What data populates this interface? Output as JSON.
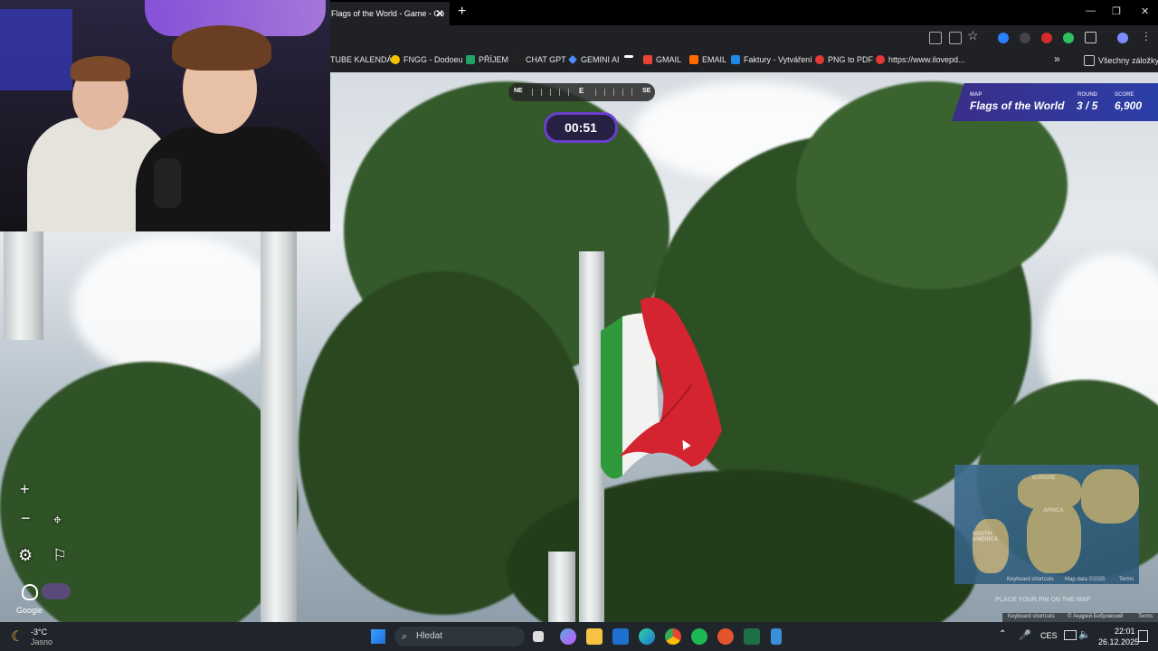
{
  "browser": {
    "tab_title": "Flags of the World - Game - Ge",
    "new_tab": "+",
    "close_tab": "✕",
    "window": {
      "minimize": "—",
      "restore": "❐",
      "close": "✕"
    },
    "bookmarks": [
      {
        "label": "TUBE KALENDÁŘ",
        "color": "#ff0000"
      },
      {
        "label": "FNGG - Dodoeu",
        "color": "#f5c400"
      },
      {
        "label": "PŘÍJEM",
        "color": "#1fa463"
      },
      {
        "label": "CHAT GPT",
        "color": "#222222"
      },
      {
        "label": "GEMINI AI",
        "color": "#4f8cff"
      },
      {
        "label": "",
        "color": "#ffffff"
      },
      {
        "label": "GMAIL",
        "color": "#ea4335"
      },
      {
        "label": "EMAIL",
        "color": "#ff6a00"
      },
      {
        "label": "Faktury - Vytváření",
        "color": "#1e88e5"
      },
      {
        "label": "PNG to PDF",
        "color": "#e53935"
      },
      {
        "label": "https://www.ilovepd...",
        "color": "#e53935"
      }
    ],
    "bookmarks_more": "»",
    "all_bookmarks": "Všechny záložky"
  },
  "hud": {
    "compass": {
      "left": "NE",
      "center": "E",
      "right": "SE"
    },
    "timer": "00:51",
    "map_label": "MAP",
    "map_name": "Flags of the World",
    "round_label": "ROUND",
    "round_value": "3 / 5",
    "score_label": "SCORE",
    "score_value": "6,900"
  },
  "controls": {
    "zoom_in": "+",
    "zoom_out": "−",
    "settings_icon": "⚙",
    "flag_icon": "⚐",
    "pin_icon": "⌖"
  },
  "minimap": {
    "labels": [
      "EUROPE",
      "AFRICA",
      "SOUTH AMERICA"
    ],
    "footer": [
      "Keyboard shortcuts",
      "Map data ©2025",
      "Terms"
    ],
    "place_hint": "PLACE YOUR PIN ON THE MAP"
  },
  "streetview_footer": [
    "Keyboard shortcuts",
    "© Андрей Бобровский",
    "Terms"
  ],
  "google_logo": "Google",
  "taskbar": {
    "weather_temp": "-3°C",
    "weather_text": "Jasno",
    "search_placeholder": "Hledat",
    "lang": "CES",
    "time": "22:01",
    "date": "26.12.2025"
  }
}
